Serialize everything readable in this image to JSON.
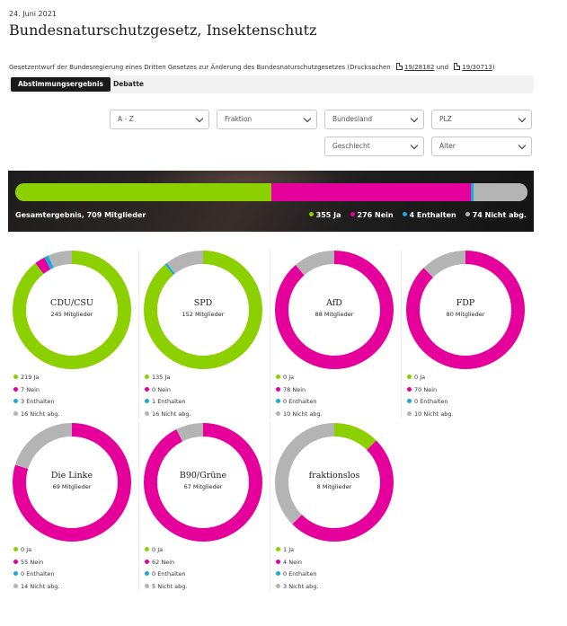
{
  "header": {
    "date": "24. Juni 2021",
    "title": "Bundesnaturschutzgesetz, Insektenschutz",
    "subline_prefix": "Gesetzentwurf der Bundesregierung eines Dritten Gesetzes zur Änderung des Bundesnaturschutzgesetzes (Drucksachen",
    "doc1": "19/28182",
    "subline_and": "und",
    "doc2": "19/30713",
    "subline_suffix": ")"
  },
  "tabs": [
    {
      "label": "Abstimmungsergebnis",
      "active": true
    },
    {
      "label": "Debatte",
      "active": false
    }
  ],
  "filters": {
    "sort": "A - Z",
    "fraktion": "Fraktion",
    "bundesland": "Bundesland",
    "plz": "PLZ",
    "geschlecht": "Geschlecht",
    "alter": "Alter"
  },
  "colors": {
    "ja": "#8cd000",
    "nein": "#e5009c",
    "enthalten": "#19a8df",
    "nicht": "#b4b4b4"
  },
  "total": {
    "label": "Gesamtergebnis, 709 Mitglieder",
    "ja": 355,
    "nein": 276,
    "enthalten": 4,
    "nicht": 74,
    "ja_label": "355 Ja",
    "nein_label": "276 Nein",
    "enthalten_label": "4 Enthalten",
    "nicht_label": "74 Nicht abg."
  },
  "parties": [
    {
      "name": "CDU/CSU",
      "members": "245 Mitglieder",
      "ja": 219,
      "nein": 7,
      "enthalten": 3,
      "nicht": 16,
      "ja_label": "219 Ja",
      "nein_label": "7 Nein",
      "enthalten_label": "3 Enthalten",
      "nicht_label": "16 Nicht abg."
    },
    {
      "name": "SPD",
      "members": "152 Mitglieder",
      "ja": 135,
      "nein": 0,
      "enthalten": 1,
      "nicht": 16,
      "ja_label": "135 Ja",
      "nein_label": "0 Nein",
      "enthalten_label": "1 Enthalten",
      "nicht_label": "16 Nicht abg."
    },
    {
      "name": "AfD",
      "members": "88 Mitglieder",
      "ja": 0,
      "nein": 78,
      "enthalten": 0,
      "nicht": 10,
      "ja_label": "0 Ja",
      "nein_label": "78 Nein",
      "enthalten_label": "0 Enthalten",
      "nicht_label": "10 Nicht abg."
    },
    {
      "name": "FDP",
      "members": "80 Mitglieder",
      "ja": 0,
      "nein": 70,
      "enthalten": 0,
      "nicht": 10,
      "ja_label": "0 Ja",
      "nein_label": "70 Nein",
      "enthalten_label": "0 Enthalten",
      "nicht_label": "10 Nicht abg."
    },
    {
      "name": "Die Linke",
      "members": "69 Mitglieder",
      "ja": 0,
      "nein": 55,
      "enthalten": 0,
      "nicht": 14,
      "ja_label": "0 Ja",
      "nein_label": "55 Nein",
      "enthalten_label": "0 Enthalten",
      "nicht_label": "14 Nicht abg."
    },
    {
      "name": "B90/Grüne",
      "members": "67 Mitglieder",
      "ja": 0,
      "nein": 62,
      "enthalten": 0,
      "nicht": 5,
      "ja_label": "0 Ja",
      "nein_label": "62 Nein",
      "enthalten_label": "0 Enthalten",
      "nicht_label": "5 Nicht abg."
    },
    {
      "name": "fraktionslos",
      "members": "8 Mitglieder",
      "ja": 1,
      "nein": 4,
      "enthalten": 0,
      "nicht": 3,
      "ja_label": "1 Ja",
      "nein_label": "4 Nein",
      "enthalten_label": "0 Enthalten",
      "nicht_label": "3 Nicht abg."
    }
  ]
}
